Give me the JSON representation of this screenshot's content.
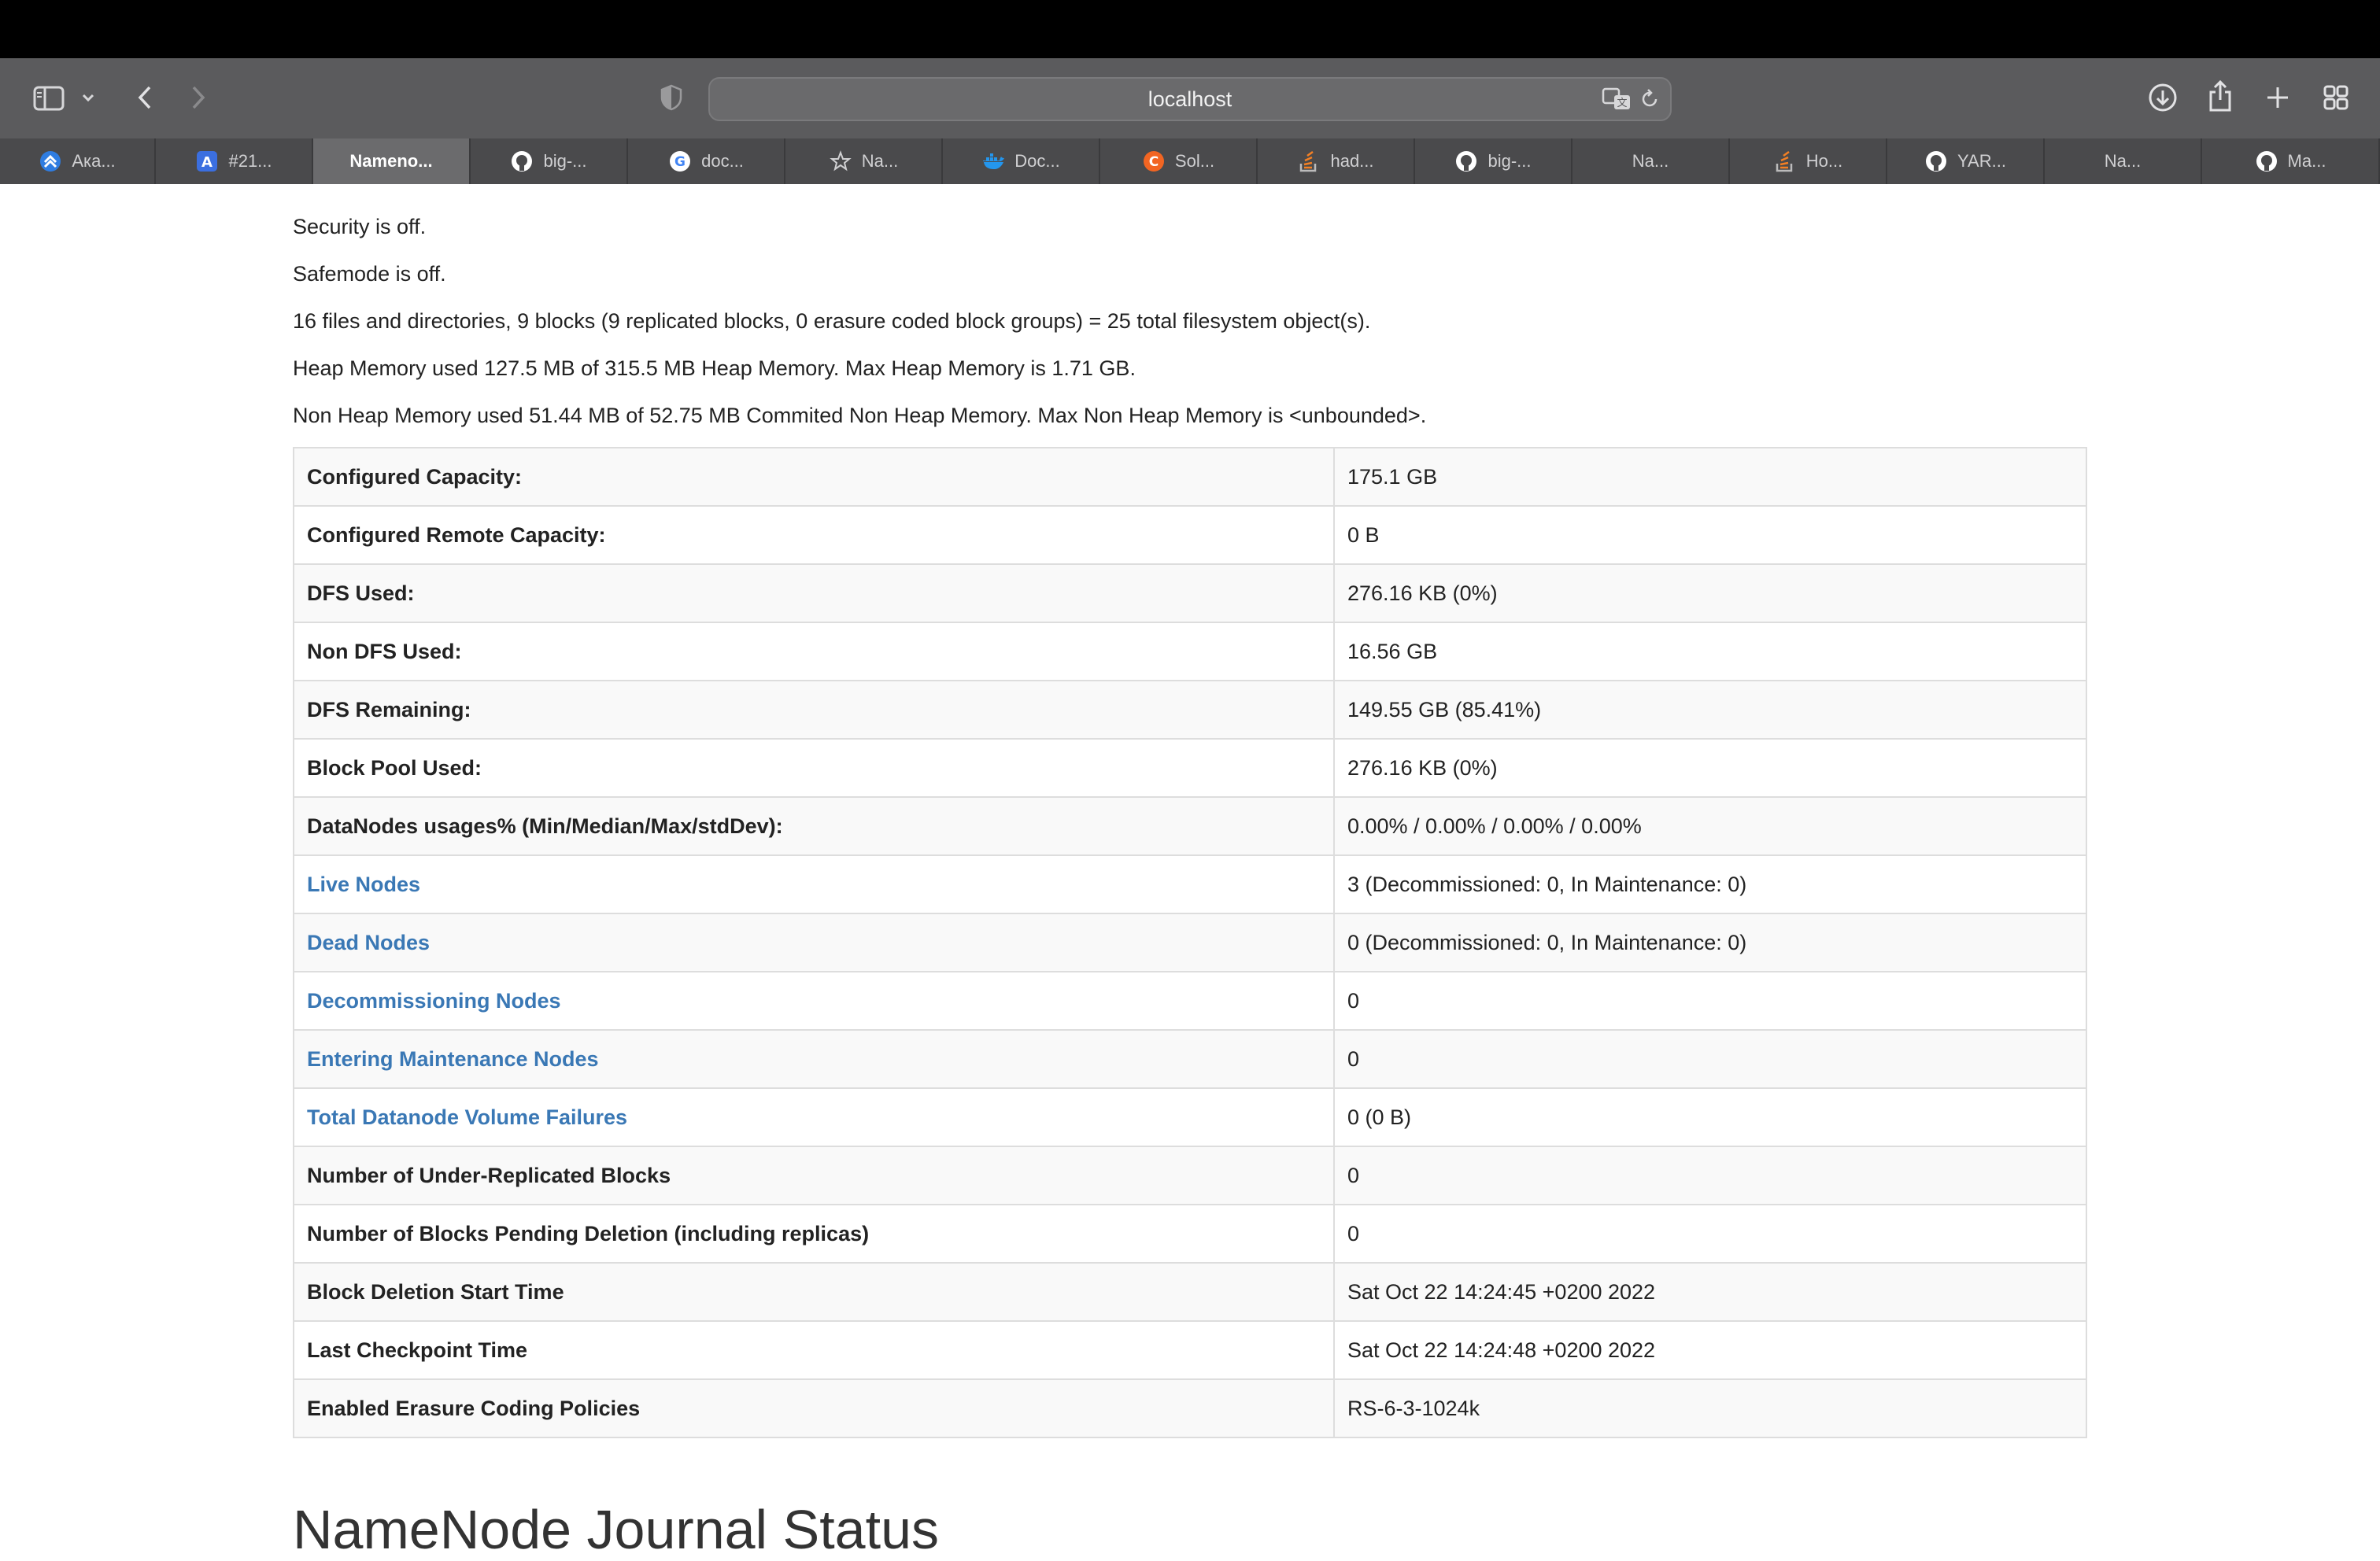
{
  "browser": {
    "address": "localhost",
    "tabs": [
      {
        "label": "Aка...",
        "fav_icon": "chevron-up-icon",
        "fav_color": "#2f7de1"
      },
      {
        "label": "#21...",
        "fav_icon": "letter-a-icon",
        "fav_color": "#3b6fe0"
      },
      {
        "label": "Nameno...",
        "fav_icon": "",
        "fav_color": ""
      },
      {
        "label": "big-...",
        "fav_icon": "github-icon",
        "fav_color": "#ffffff"
      },
      {
        "label": "doc...",
        "fav_icon": "google-icon",
        "fav_color": "#ffffff"
      },
      {
        "label": "Na...",
        "fav_icon": "star-icon",
        "fav_color": "#d0d0d2"
      },
      {
        "label": "Doc...",
        "fav_icon": "docker-icon",
        "fav_color": "#2496ed"
      },
      {
        "label": "Sol...",
        "fav_icon": "circle-c-icon",
        "fav_color": "#f26522"
      },
      {
        "label": "had...",
        "fav_icon": "stackoverflow-icon",
        "fav_color": "#f48024"
      },
      {
        "label": "big-...",
        "fav_icon": "github-icon",
        "fav_color": "#ffffff"
      },
      {
        "label": "Na...",
        "fav_icon": "",
        "fav_color": ""
      },
      {
        "label": "Ho...",
        "fav_icon": "stackoverflow-icon",
        "fav_color": "#f48024"
      },
      {
        "label": "YAR...",
        "fav_icon": "github-icon",
        "fav_color": "#ffffff"
      },
      {
        "label": "Na...",
        "fav_icon": "",
        "fav_color": ""
      },
      {
        "label": "Ma...",
        "fav_icon": "github-icon",
        "fav_color": "#ffffff"
      }
    ]
  },
  "summary": {
    "lines": [
      "Security is off.",
      "Safemode is off.",
      "16 files and directories, 9 blocks (9 replicated blocks, 0 erasure coded block groups) = 25 total filesystem object(s).",
      "Heap Memory used 127.5 MB of 315.5 MB Heap Memory. Max Heap Memory is 1.71 GB.",
      "Non Heap Memory used 51.44 MB of 52.75 MB Commited Non Heap Memory. Max Non Heap Memory is <unbounded>."
    ],
    "rows": [
      {
        "key": "Configured Capacity:",
        "value": "175.1 GB",
        "link": false
      },
      {
        "key": "Configured Remote Capacity:",
        "value": "0 B",
        "link": false
      },
      {
        "key": "DFS Used:",
        "value": "276.16 KB (0%)",
        "link": false
      },
      {
        "key": "Non DFS Used:",
        "value": "16.56 GB",
        "link": false
      },
      {
        "key": "DFS Remaining:",
        "value": "149.55 GB (85.41%)",
        "link": false
      },
      {
        "key": "Block Pool Used:",
        "value": "276.16 KB (0%)",
        "link": false
      },
      {
        "key": "DataNodes usages% (Min/Median/Max/stdDev):",
        "value": "0.00% / 0.00% / 0.00% / 0.00%",
        "link": false
      },
      {
        "key": "Live Nodes",
        "value": "3 (Decommissioned: 0, In Maintenance: 0)",
        "link": true
      },
      {
        "key": "Dead Nodes",
        "value": "0 (Decommissioned: 0, In Maintenance: 0)",
        "link": true
      },
      {
        "key": "Decommissioning Nodes",
        "value": "0",
        "link": true
      },
      {
        "key": "Entering Maintenance Nodes",
        "value": "0",
        "link": true
      },
      {
        "key": "Total Datanode Volume Failures",
        "value": "0 (0 B)",
        "link": true
      },
      {
        "key": "Number of Under-Replicated Blocks",
        "value": "0",
        "link": false
      },
      {
        "key": "Number of Blocks Pending Deletion (including replicas)",
        "value": "0",
        "link": false
      },
      {
        "key": "Block Deletion Start Time",
        "value": "Sat Oct 22 14:24:45 +0200 2022",
        "link": false
      },
      {
        "key": "Last Checkpoint Time",
        "value": "Sat Oct 22 14:24:48 +0200 2022",
        "link": false
      },
      {
        "key": "Enabled Erasure Coding Policies",
        "value": "RS-6-3-1024k",
        "link": false
      }
    ]
  },
  "journal": {
    "heading": "NameNode Journal Status"
  },
  "colors": {
    "link": "#3a78b5",
    "toolbar": "#5b5b5d",
    "tabbar": "#4a4a4c"
  }
}
